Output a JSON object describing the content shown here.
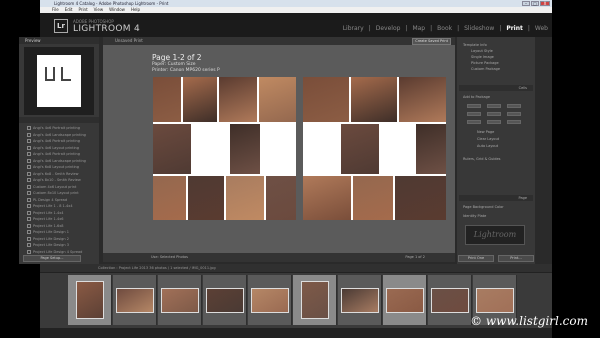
{
  "window": {
    "title": "Lightroom 4 Catalog - Adobe Photoshop Lightroom - Print",
    "buttons": [
      "–",
      "□",
      "X"
    ]
  },
  "menu": [
    "File",
    "Edit",
    "Print",
    "View",
    "Window",
    "Help"
  ],
  "identity": {
    "logo": "Lr",
    "adobe": "ADOBE PHOTOSHOP",
    "product": "LIGHTROOM 4",
    "modules": [
      "Library",
      "|",
      "Develop",
      "|",
      "Map",
      "|",
      "Book",
      "|",
      "Slideshow",
      "|",
      "Print",
      "|",
      "Web"
    ],
    "active_module": "Print"
  },
  "left_panel": {
    "preview_header": "Preview",
    "pagesetup_label": "Page Setup...",
    "templates": [
      "Angi's 4x6 Portrait printing",
      "Angi's 4x6 Landscape printing",
      "Angi's 4x6 Portrait printing",
      "Angi's 4x6 Layout printing",
      "Angi's 4x6 Portrait printing",
      "Angi's 4x6 Landscape printing",
      "Angi's 6x8 Layout printing",
      "Angi's 6x8 - Smith Review",
      "Angi's 8x10 - Smith Review",
      "Custom 4x6 Layout print",
      "Custom 8x10 Layout print",
      "PL Design 4 Spread",
      "Project Life 1 - 8 1-4x4",
      "Project Life 1-4x4",
      "Project Life 1-4x6",
      "Project Life 1-6x8",
      "Project Life Design 1",
      "Project Life Design 2",
      "Project Life Design 3",
      "Project Life Design 4 Spread"
    ]
  },
  "centre": {
    "toolbar_unsaved": "Unsaved Print",
    "create_saved": "Create Saved Print",
    "page_title": "Page 1-2 of 2",
    "paper": "Paper:  Custom Size",
    "printer": "Printer:  Canon MP620 series P",
    "bottom_left": "Use:   Selected Photos",
    "bottom_right": "Page 1 of 2"
  },
  "right_panel": {
    "rows": [
      "Template Info",
      "Layout Style",
      "Single Image",
      "Picture Package",
      "Custom Package"
    ],
    "cells_label": "Cells",
    "add_to_package": "Add to Package",
    "new_page": "New Page",
    "clear_layout": "Clear Layout",
    "auto_layout": "Auto Layout",
    "rulers": "Rulers, Grid & Guides",
    "page_header": "Page",
    "page_bg": "Page Background Color",
    "identity_plate": "Identity Plate",
    "identity_text": "Lightroom",
    "print_to_file": "Print To File...",
    "print_one": "Print One",
    "print_button": "Print..."
  },
  "filmstrip": {
    "info": "Collection : Project Life 2013     36 photos / 1 selected / IMG_0011.jpg",
    "watermark": "www.listgirl.com",
    "copyright": "©"
  },
  "colors": {
    "window": "#2a2a2a",
    "panel": "#383838",
    "canvas": "#5b5b5b",
    "sheet": "#ffffff",
    "active_module": "#ffffff"
  }
}
